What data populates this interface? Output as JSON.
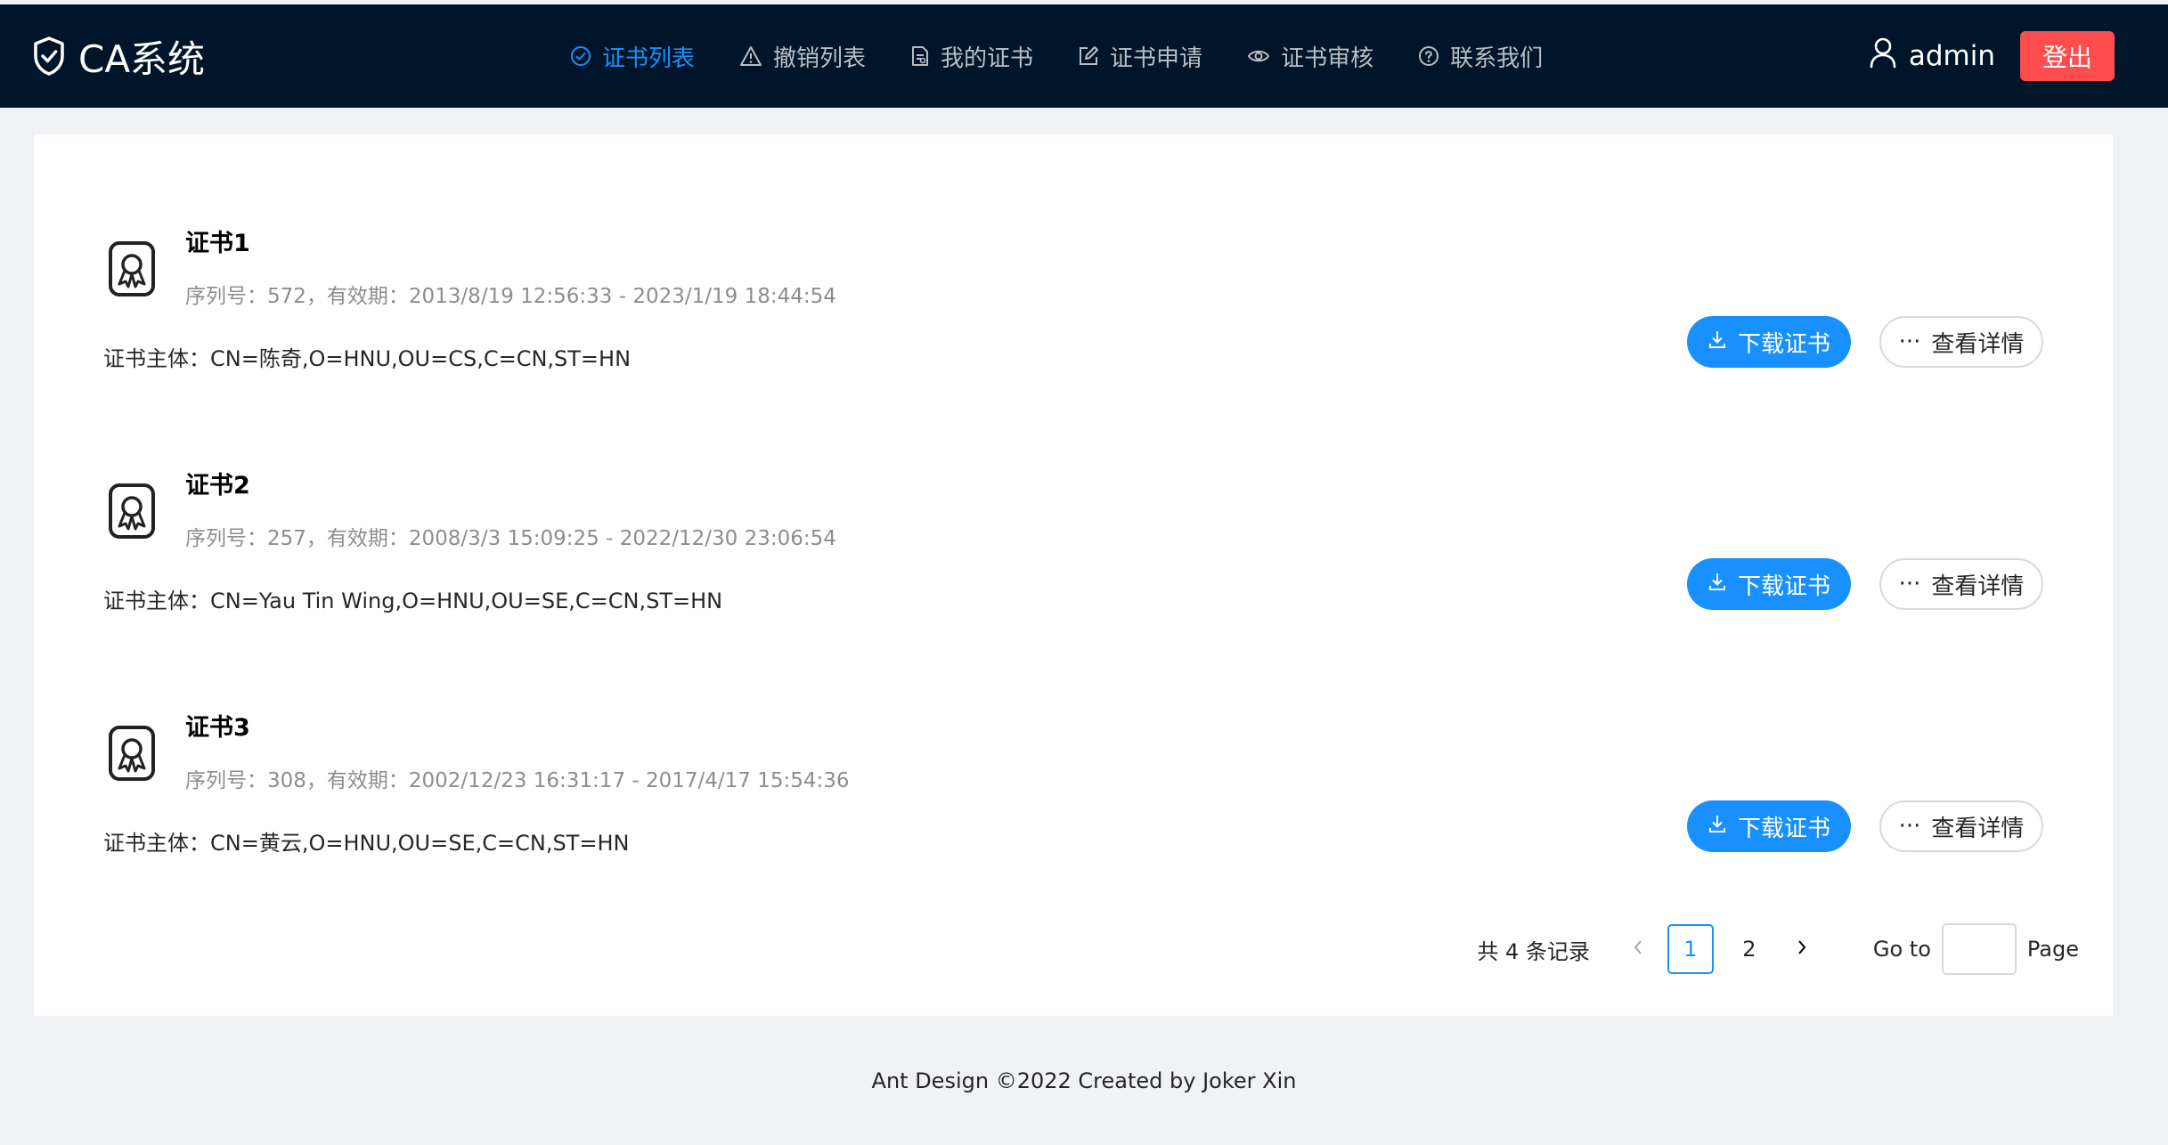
{
  "header": {
    "brand": "CA系统",
    "nav": [
      {
        "label": "证书列表",
        "icon": "check-circle-icon",
        "active": true
      },
      {
        "label": "撤销列表",
        "icon": "warning-icon",
        "active": false
      },
      {
        "label": "我的证书",
        "icon": "file-icon",
        "active": false
      },
      {
        "label": "证书申请",
        "icon": "edit-icon",
        "active": false
      },
      {
        "label": "证书审核",
        "icon": "eye-icon",
        "active": false
      },
      {
        "label": "联系我们",
        "icon": "question-circle-icon",
        "active": false
      }
    ],
    "user": "admin",
    "logout": "登出"
  },
  "certs": [
    {
      "title": "证书1",
      "meta": "序列号：572，有效期：2013/8/19 12:56:33 - 2023/1/19 18:44:54",
      "subject": "证书主体：CN=陈奇,O=HNU,OU=CS,C=CN,ST=HN",
      "download": "下载证书",
      "detail": "查看详情"
    },
    {
      "title": "证书2",
      "meta": "序列号：257，有效期：2008/3/3 15:09:25 - 2022/12/30 23:06:54",
      "subject": "证书主体：CN=Yau Tin Wing,O=HNU,OU=SE,C=CN,ST=HN",
      "download": "下载证书",
      "detail": "查看详情"
    },
    {
      "title": "证书3",
      "meta": "序列号：308，有效期：2002/12/23 16:31:17 - 2017/4/17 15:54:36",
      "subject": "证书主体：CN=黄云,O=HNU,OU=SE,C=CN,ST=HN",
      "download": "下载证书",
      "detail": "查看详情"
    }
  ],
  "pagination": {
    "total": "共 4 条记录",
    "pages": [
      "1",
      "2"
    ],
    "current": "1",
    "goto": "Go to",
    "page": "Page",
    "goto_value": ""
  },
  "footer": "Ant Design ©2022 Created by Joker Xin",
  "colors": {
    "header_bg": "#001529",
    "primary": "#1890ff",
    "danger": "#ff4d4f"
  }
}
